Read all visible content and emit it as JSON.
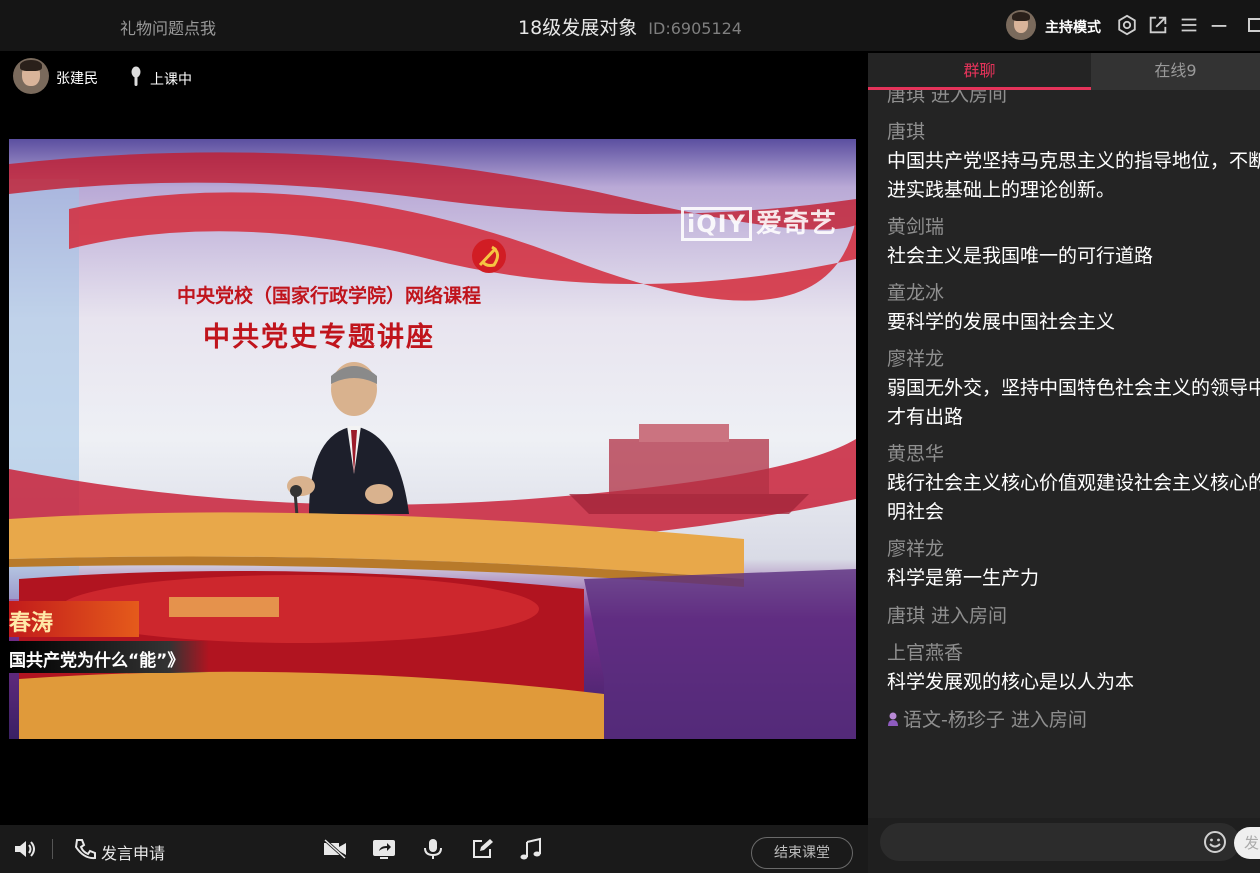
{
  "titlebar": {
    "gift_link": "礼物问题点我",
    "room_name": "18级发展对象",
    "room_id": "ID:6905124",
    "host_mode_label": "主持模式"
  },
  "stage": {
    "teacher_name": "张建民",
    "status": "上课中"
  },
  "video": {
    "watermark_logo": "iQIY",
    "watermark_text": "爱奇艺",
    "banner_line1": "中央党校（国家行政学院）网络课程",
    "banner_line2": "中共党史专题讲座",
    "caption_name": "春涛",
    "caption_topic": "国共产党为什么“能”》"
  },
  "toolbar": {
    "apply_label": "发言申请",
    "end_class_label": "结束课堂"
  },
  "chat": {
    "tab_chat": "群聊",
    "tab_online": "在线9",
    "top_entry": "唐琪 进入房间",
    "messages": [
      {
        "user": "唐琪",
        "text": "中国共产党坚持马克思主义的指导地位，不断推进实践基础上的理论创新。"
      },
      {
        "user": "黄剑瑞",
        "text": "社会主义是我国唯一的可行道路"
      },
      {
        "user": "童龙冰",
        "text": "要科学的发展中国社会主义"
      },
      {
        "user": "廖祥龙",
        "text": "弱国无外交，坚持中国特色社会主义的领导中国才有出路"
      },
      {
        "user": "黄思华",
        "text": "践行社会主义核心价值观建设社会主义核心的文明社会"
      },
      {
        "user": "廖祥龙",
        "text": "科学是第一生产力"
      }
    ],
    "entry_mid": "唐琪 进入房间",
    "messages_after": [
      {
        "user": "上官燕香",
        "text": "科学发展观的核心是以人为本"
      }
    ],
    "entry_last": "语文-杨珍子 进入房间",
    "send_label": "发"
  },
  "colors": {
    "accent": "#e5335a",
    "panel_bg": "#242424",
    "titlebar_bg": "#151515"
  }
}
